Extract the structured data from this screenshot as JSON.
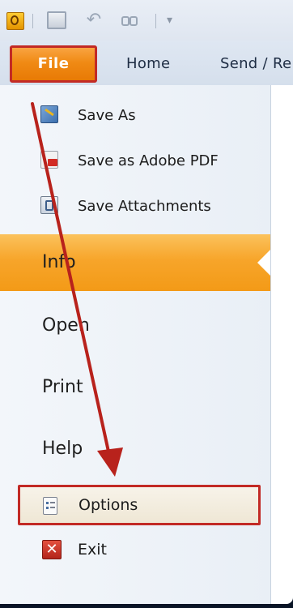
{
  "quick_access": {
    "icons": [
      "outlook-app-icon",
      "save-icon",
      "undo-icon",
      "find-icon",
      "customize-dropdown-icon"
    ]
  },
  "ribbon": {
    "file_tab": "File",
    "tabs": [
      "Home",
      "Send / Re"
    ]
  },
  "backstage": {
    "commands": [
      {
        "label": "Save As",
        "icon": "save-as-icon"
      },
      {
        "label": "Save as Adobe PDF",
        "icon": "pdf-icon"
      },
      {
        "label": "Save Attachments",
        "icon": "attachments-icon"
      }
    ],
    "nav": {
      "info": "Info",
      "open": "Open",
      "print": "Print",
      "help": "Help"
    },
    "options": "Options",
    "exit": "Exit",
    "exit_glyph": "✕"
  },
  "colors": {
    "file_tab": "#f08a14",
    "info_highlight": "#f7a52a",
    "callout_border": "#c22a25",
    "arrow": "#b8221c"
  }
}
